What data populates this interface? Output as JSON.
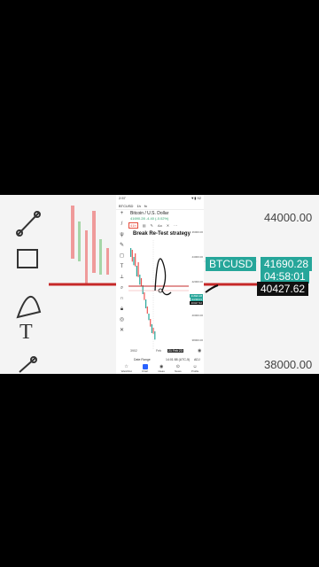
{
  "status": {
    "time": "2:57",
    "right": "▼▮ 92"
  },
  "toolbar_top": {
    "symbol": "BTCUSD",
    "interval": "1h",
    "indicator": "fx"
  },
  "header": {
    "pair": "Bitcoin / U.S. Dollar",
    "quote": "41690.28 -4.40 (-0.02%)"
  },
  "chart_tools": {
    "active": "41h",
    "items": [
      "▤",
      "✎",
      "Aa",
      "✕",
      "⋯"
    ]
  },
  "strategy_title": "Break Re-Test strategy",
  "right_axis": [
    "46000.00",
    "44000.00",
    "42000.00",
    "40000.00",
    "38000.00"
  ],
  "right_tags": {
    "price": "41690.28",
    "time": "04:58:01",
    "level": "40427.62"
  },
  "bottom_axis": [
    "3902",
    "Feb",
    "21 Feb 23",
    "◉"
  ],
  "range_bar": {
    "label": "Date Range",
    "time": "14:01:58 (UTC-5)",
    "adj": "ADJ"
  },
  "bottom_nav": [
    "Watchlist",
    "Chart",
    "Ideas",
    "News",
    "Profile"
  ],
  "background": {
    "prices": [
      "44000.00",
      "40427.62",
      "38000.00"
    ],
    "tag_symbol": "BTCUSD",
    "tag_price": "41690.28",
    "tag_time": "04:58:01"
  },
  "colors": {
    "up": "#26a69a",
    "down": "#ef5350",
    "line": "#c62828",
    "accent": "#2962ff"
  }
}
